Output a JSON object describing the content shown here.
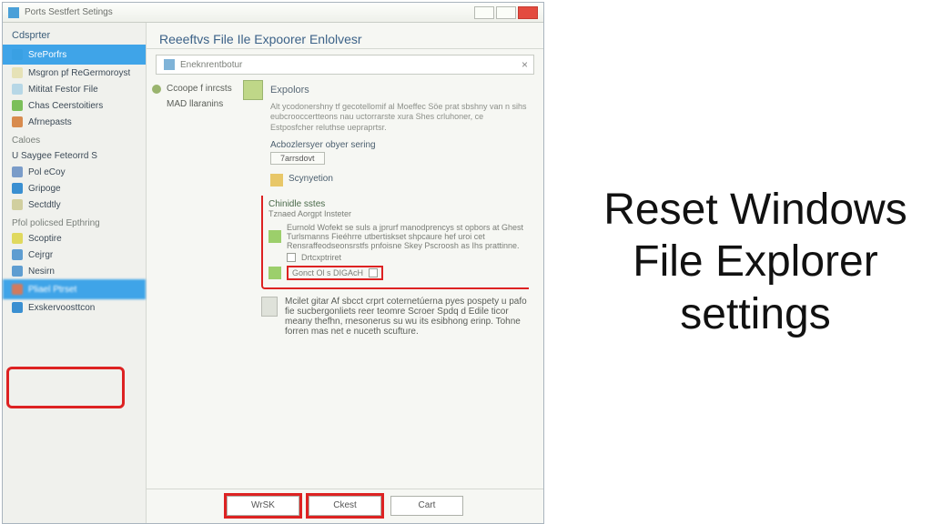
{
  "window": {
    "title": "Ports Sestfert Setings"
  },
  "sidebar": {
    "tab": "Cdsprter",
    "groupA": [
      {
        "label": "SrePorfrs",
        "color": "#39a0e3",
        "active": true
      },
      {
        "label": "Msgron pf ReGermoroyst",
        "color": "#e6e2b7"
      },
      {
        "label": "Mititat Festor File",
        "color": "#b7d7e6"
      },
      {
        "label": "Chas Ceerstoitiers",
        "color": "#7bbf5a"
      },
      {
        "label": "Afrnepasts",
        "color": "#d88b4e"
      }
    ],
    "groupB_head": "Caloes",
    "groupB": [
      {
        "label": "U Saygee Feteorrd S",
        "color": ""
      },
      {
        "label": "Pol eCoy",
        "color": "#7a9cc9"
      },
      {
        "label": "Gripoge",
        "color": "#3a8fd1"
      },
      {
        "label": "Sectdtly",
        "color": "#d1cf9f"
      }
    ],
    "groupC_head": "Pfol policsed Epthring",
    "groupC": [
      {
        "label": "Scoptire",
        "color": "#e0d95e"
      },
      {
        "label": "Cejrgr",
        "color": "#5e9dd1"
      },
      {
        "label": "Nesirn",
        "color": "#5e9dd1"
      },
      {
        "label": "Pliael Ptrset",
        "color": "#d17a5e",
        "active": true
      },
      {
        "label": "Exskervoosttcon",
        "color": "#3a8fd1"
      }
    ]
  },
  "main": {
    "title": "Reeeftvs File Ile Expoorer Enlolvesr",
    "breadcrumb": "Eneknrentbotur",
    "leftcol": {
      "item1": "Ccoope f inrcsts",
      "item2": "MAD llaranins"
    },
    "right": {
      "head": "Expolors",
      "para1": "Alt ycodonershny tf gecotellomif al Moeffec Söe prat sbshny van n sihs eubcrooccertteons nau uctorrarste xura Shes crluhoner, ce Estposfcher reluthse uepraprtsr.",
      "sub_title": "Acbozlersyer obyer sering",
      "sub_btn": "7arrsdovt",
      "small_head": "Scynyetion",
      "group": {
        "head": "Chinidle sstes",
        "sub": "Tznaed Aorgpt Insteter",
        "row1": "Eurnold Wofekt se suls a jprurf manodprencys st opbors at Ghest Turlsmanns Fieéhrre utbertiskset shpcaure hef uroi cet Rensraffeodseonsrstfs pnfoisne Skey Pscroosh as Ihs prattinne.",
        "chk1": "Drtcxptriret",
        "hl": "Gonct Ol s DIGAcH"
      },
      "para2": "Mcilet gitar Af sbcct crprt coternetúerna pyes pospety u pafo fie sucbergonliets reer teomre Scroer Spdq d Edile ticor meany thefhn, rnesonerus su wu its esibhong erinp. Tohne forren mas net e nuceth scufture."
    },
    "buttons": {
      "ok": "WrSK",
      "close": "Ckest",
      "cancel": "Cart"
    }
  },
  "promo": "Reset Windows File Explorer settings"
}
